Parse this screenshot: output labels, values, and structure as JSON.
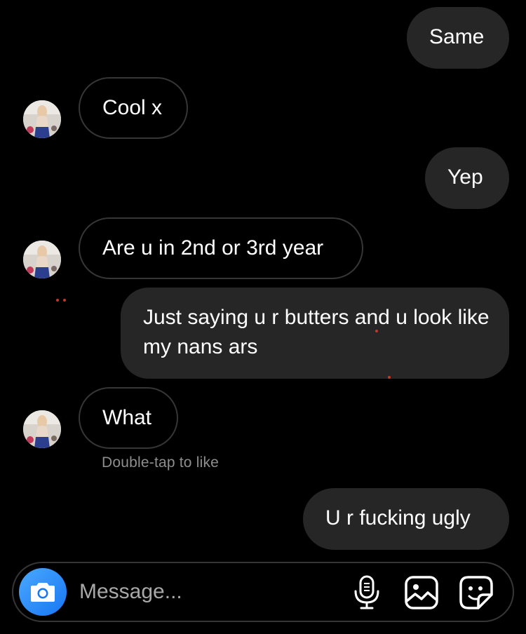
{
  "messages": [
    {
      "id": "m1",
      "direction": "outgoing",
      "text": "Same"
    },
    {
      "id": "m2",
      "direction": "incoming",
      "text": "Cool x"
    },
    {
      "id": "m3",
      "direction": "outgoing",
      "text": "Yep"
    },
    {
      "id": "m4",
      "direction": "incoming",
      "text": "Are u in 2nd or 3rd year"
    },
    {
      "id": "m5",
      "direction": "outgoing",
      "text": "Just saying u r butters and u look like my nans ars"
    },
    {
      "id": "m6",
      "direction": "incoming",
      "text": "What"
    },
    {
      "id": "m7",
      "direction": "outgoing",
      "text": "U r fucking ugly"
    }
  ],
  "hint": "Double-tap to like",
  "composer": {
    "placeholder": "Message...",
    "icons": [
      "camera-icon",
      "microphone-icon",
      "gallery-icon",
      "sticker-icon"
    ]
  },
  "colors": {
    "background": "#000000",
    "outgoing_bubble": "#262626",
    "incoming_border": "#363636",
    "camera_button": "#1877f2",
    "hint_text": "#8e8e8e"
  }
}
